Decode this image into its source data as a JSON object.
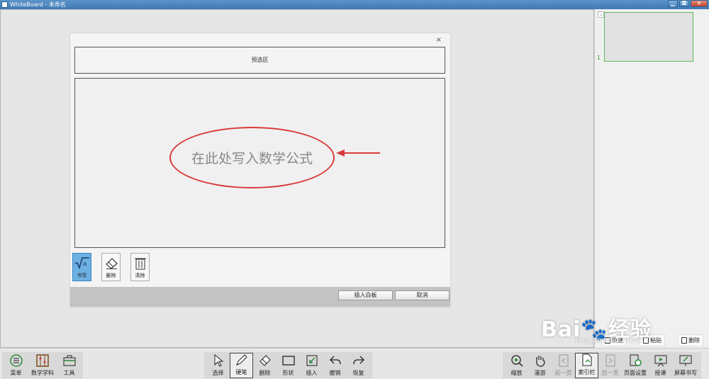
{
  "window": {
    "title": "WhiteBoard - 未命名",
    "min": "▁",
    "max": "◘",
    "close": "✕"
  },
  "dialog": {
    "close": "×",
    "preview_label": "预选区",
    "hint_text": "在此处写入数学公式",
    "tools": [
      {
        "name": "write",
        "label": "书写",
        "icon": "handwrite-sqrt-icon"
      },
      {
        "name": "erase",
        "label": "删除",
        "icon": "eraser-icon"
      },
      {
        "name": "clear",
        "label": "清除",
        "icon": "trash-icon"
      }
    ],
    "insert_label": "插入白板",
    "cancel_label": "取消"
  },
  "right_panel": {
    "page_number": "1",
    "buttons": [
      {
        "label": "新建",
        "icon": "new-page-icon"
      },
      {
        "label": "粘贴",
        "icon": "paste-icon"
      },
      {
        "label": "删除",
        "icon": "trash-icon"
      }
    ]
  },
  "toolbar": {
    "left": [
      {
        "label": "菜单",
        "icon": "menu-circle-icon"
      },
      {
        "label": "数学学科",
        "icon": "abacus-icon"
      },
      {
        "label": "工具",
        "icon": "toolbox-icon"
      }
    ],
    "center": [
      {
        "label": "选择",
        "icon": "cursor-icon"
      },
      {
        "label": "硬笔",
        "icon": "pen-icon"
      },
      {
        "label": "删除",
        "icon": "eraser-icon"
      },
      {
        "label": "形状",
        "icon": "rectangle-icon"
      },
      {
        "label": "插入",
        "icon": "insert-icon"
      },
      {
        "label": "撤销",
        "icon": "undo-icon"
      },
      {
        "label": "恢复",
        "icon": "redo-icon"
      }
    ],
    "right": [
      {
        "label": "缩放",
        "icon": "zoom-icon"
      },
      {
        "label": "漫游",
        "icon": "hand-icon"
      },
      {
        "label": "前一页",
        "icon": "prev-page-icon"
      },
      {
        "label": "索引栏",
        "icon": "index-bar-icon"
      },
      {
        "label": "后一页",
        "icon": "next-page-icon"
      },
      {
        "label": "页面设置",
        "icon": "page-settings-icon"
      },
      {
        "label": "授课",
        "icon": "lecture-icon"
      },
      {
        "label": "屏幕书写",
        "icon": "screen-write-icon"
      }
    ]
  },
  "watermark": {
    "brand": "Bai🐾经验",
    "url": "jingyan.baidu.com"
  },
  "colors": {
    "annotation_red": "#d93a3a",
    "selected_tool": "#6cb0e4",
    "page_accent": "#5cb85c"
  }
}
